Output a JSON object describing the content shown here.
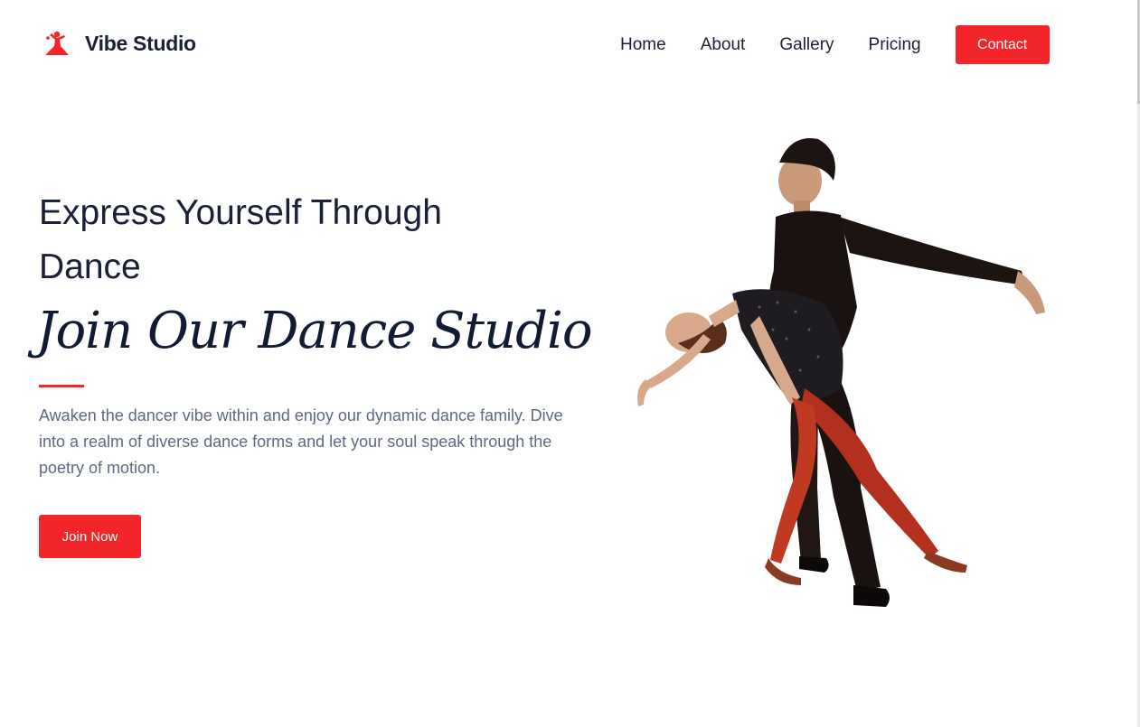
{
  "brand": {
    "name": "Vibe Studio",
    "icon": "dancer-logo-icon",
    "accent": "#f2252b"
  },
  "nav": {
    "items": [
      {
        "label": "Home"
      },
      {
        "label": "About"
      },
      {
        "label": "Gallery"
      },
      {
        "label": "Pricing"
      }
    ],
    "contact_label": "Contact"
  },
  "hero": {
    "title": "Express Yourself Through Dance",
    "script_title": "Join Our Dance Studio",
    "description": "Awaken the dancer vibe within and enjoy our dynamic dance family. Dive into a realm of diverse dance forms and let your soul speak through the poetry of motion.",
    "cta_label": "Join Now",
    "image": "dancing-couple-image"
  },
  "colors": {
    "text_dark": "#1a2035",
    "text_muted": "#5d6a82",
    "background": "#ffffff"
  }
}
